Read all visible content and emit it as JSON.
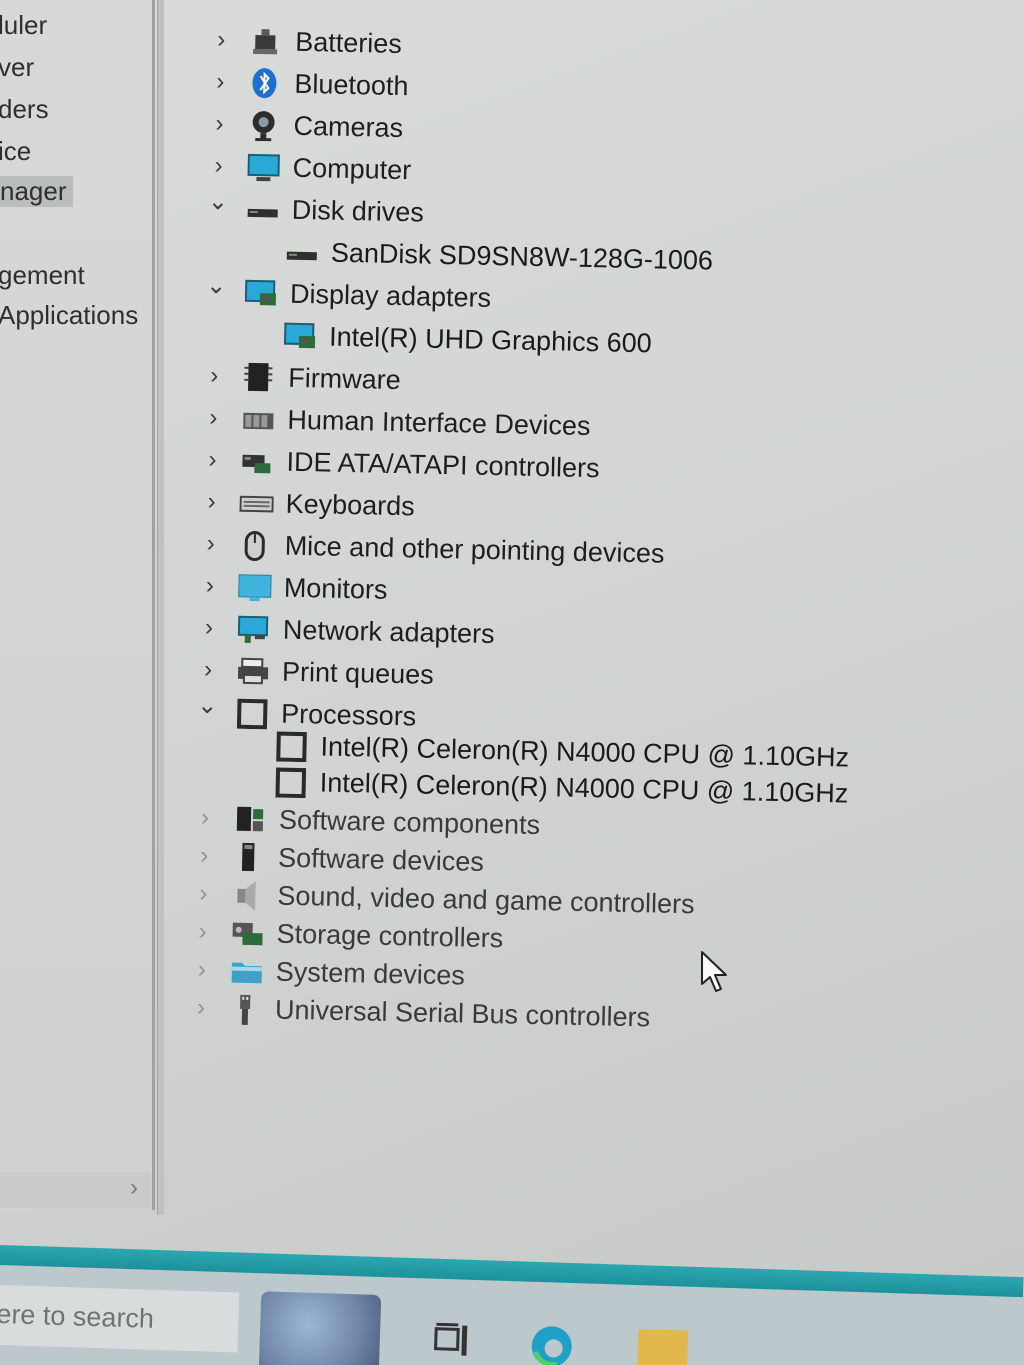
{
  "left_nav": {
    "items": [
      {
        "label": "luler"
      },
      {
        "label": "ver"
      },
      {
        "label": "ders"
      },
      {
        "label": "ice"
      },
      {
        "label": "nager",
        "selected": true
      },
      {
        "label": "gement"
      },
      {
        "label": "Applications"
      }
    ]
  },
  "device_tree": {
    "rows": [
      {
        "label": "Batteries",
        "expanded": false,
        "icon": "battery-icon"
      },
      {
        "label": "Bluetooth",
        "expanded": false,
        "icon": "bluetooth-icon"
      },
      {
        "label": "Cameras",
        "expanded": false,
        "icon": "camera-icon"
      },
      {
        "label": "Computer",
        "expanded": false,
        "icon": "computer-icon"
      },
      {
        "label": "Disk drives",
        "expanded": true,
        "icon": "disk-drive-icon"
      },
      {
        "label": "SanDisk SD9SN8W-128G-1006",
        "child": true,
        "icon": "disk-drive-icon"
      },
      {
        "label": "Display adapters",
        "expanded": true,
        "icon": "display-adapter-icon"
      },
      {
        "label": "Intel(R) UHD Graphics 600",
        "child": true,
        "icon": "display-adapter-icon"
      },
      {
        "label": "Firmware",
        "expanded": false,
        "icon": "firmware-icon"
      },
      {
        "label": "Human Interface Devices",
        "expanded": false,
        "icon": "hid-icon"
      },
      {
        "label": "IDE ATA/ATAPI controllers",
        "expanded": false,
        "icon": "ide-controller-icon"
      },
      {
        "label": "Keyboards",
        "expanded": false,
        "icon": "keyboard-icon"
      },
      {
        "label": "Mice and other pointing devices",
        "expanded": false,
        "icon": "mouse-icon"
      },
      {
        "label": "Monitors",
        "expanded": false,
        "icon": "monitor-icon"
      },
      {
        "label": "Network adapters",
        "expanded": false,
        "icon": "network-adapter-icon"
      },
      {
        "label": "Print queues",
        "expanded": false,
        "icon": "printer-icon"
      },
      {
        "label": "Processors",
        "expanded": true,
        "icon": "processor-icon"
      },
      {
        "label": "Intel(R) Celeron(R) N4000 CPU @ 1.10GHz",
        "child": true,
        "icon": "processor-icon"
      },
      {
        "label": "Intel(R) Celeron(R) N4000 CPU @ 1.10GHz",
        "child": true,
        "icon": "processor-icon"
      },
      {
        "label": "Software components",
        "expanded": false,
        "icon": "software-component-icon"
      },
      {
        "label": "Software devices",
        "expanded": false,
        "icon": "software-device-icon"
      },
      {
        "label": "Sound, video and game controllers",
        "expanded": false,
        "icon": "speaker-icon"
      },
      {
        "label": "Storage controllers",
        "expanded": false,
        "icon": "storage-controller-icon"
      },
      {
        "label": "System devices",
        "expanded": false,
        "icon": "system-folder-icon"
      },
      {
        "label": "Universal Serial Bus controllers",
        "expanded": false,
        "icon": "usb-icon"
      }
    ]
  },
  "taskbar": {
    "search_placeholder": "ere to search"
  },
  "colors": {
    "accent_strip": "#1b8f99",
    "tree_text": "#1e1e1e",
    "selected_nav": "#b9bdbd"
  }
}
